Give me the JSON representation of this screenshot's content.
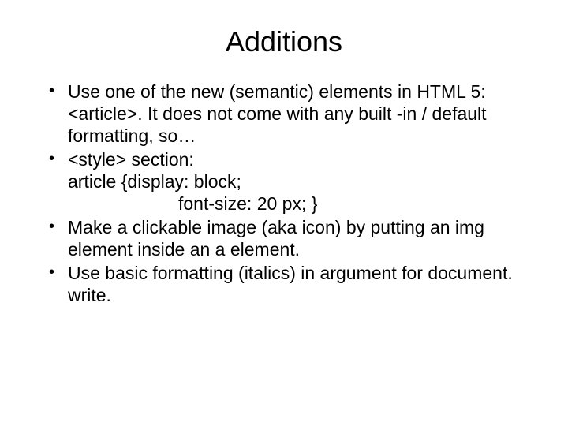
{
  "title": "Additions",
  "bullets": {
    "b1": "Use one of the new (semantic) elements in HTML 5: <article>. It does not come with any built -in / default formatting, so…",
    "b2_line1": "<style> section:",
    "b2_line2": "article {display: block;",
    "b2_line3": "font-size: 20 px; }",
    "b3": "Make a clickable image (aka icon) by putting an img element inside an a element.",
    "b4": "Use basic formatting (italics) in argument for document. write."
  }
}
